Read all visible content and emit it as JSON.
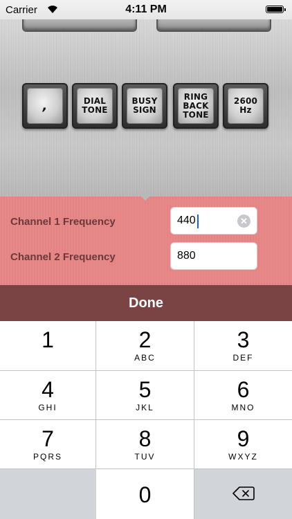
{
  "status_bar": {
    "carrier": "Carrier",
    "time": "4:11 PM"
  },
  "tone_buttons": [
    {
      "label": ","
    },
    {
      "label": "DIAL TONE"
    },
    {
      "label": "BUSY SIGN"
    },
    {
      "label": "RING BACK TONE"
    },
    {
      "label": "2600 Hz"
    }
  ],
  "frequency_panel": {
    "channel1_label": "Channel 1 Frequency",
    "channel1_value": "440",
    "channel2_label": "Channel 2 Frequency",
    "channel2_value": "880"
  },
  "done_label": "Done",
  "keypad": [
    {
      "num": "1",
      "letters": ""
    },
    {
      "num": "2",
      "letters": "ABC"
    },
    {
      "num": "3",
      "letters": "DEF"
    },
    {
      "num": "4",
      "letters": "GHI"
    },
    {
      "num": "5",
      "letters": "JKL"
    },
    {
      "num": "6",
      "letters": "MNO"
    },
    {
      "num": "7",
      "letters": "PQRS"
    },
    {
      "num": "8",
      "letters": "TUV"
    },
    {
      "num": "9",
      "letters": "WXYZ"
    },
    {
      "num": "0",
      "letters": ""
    }
  ],
  "colors": {
    "panel_pink": "#e98585",
    "done_bar": "#7b4444",
    "caret": "#1a5cff"
  }
}
